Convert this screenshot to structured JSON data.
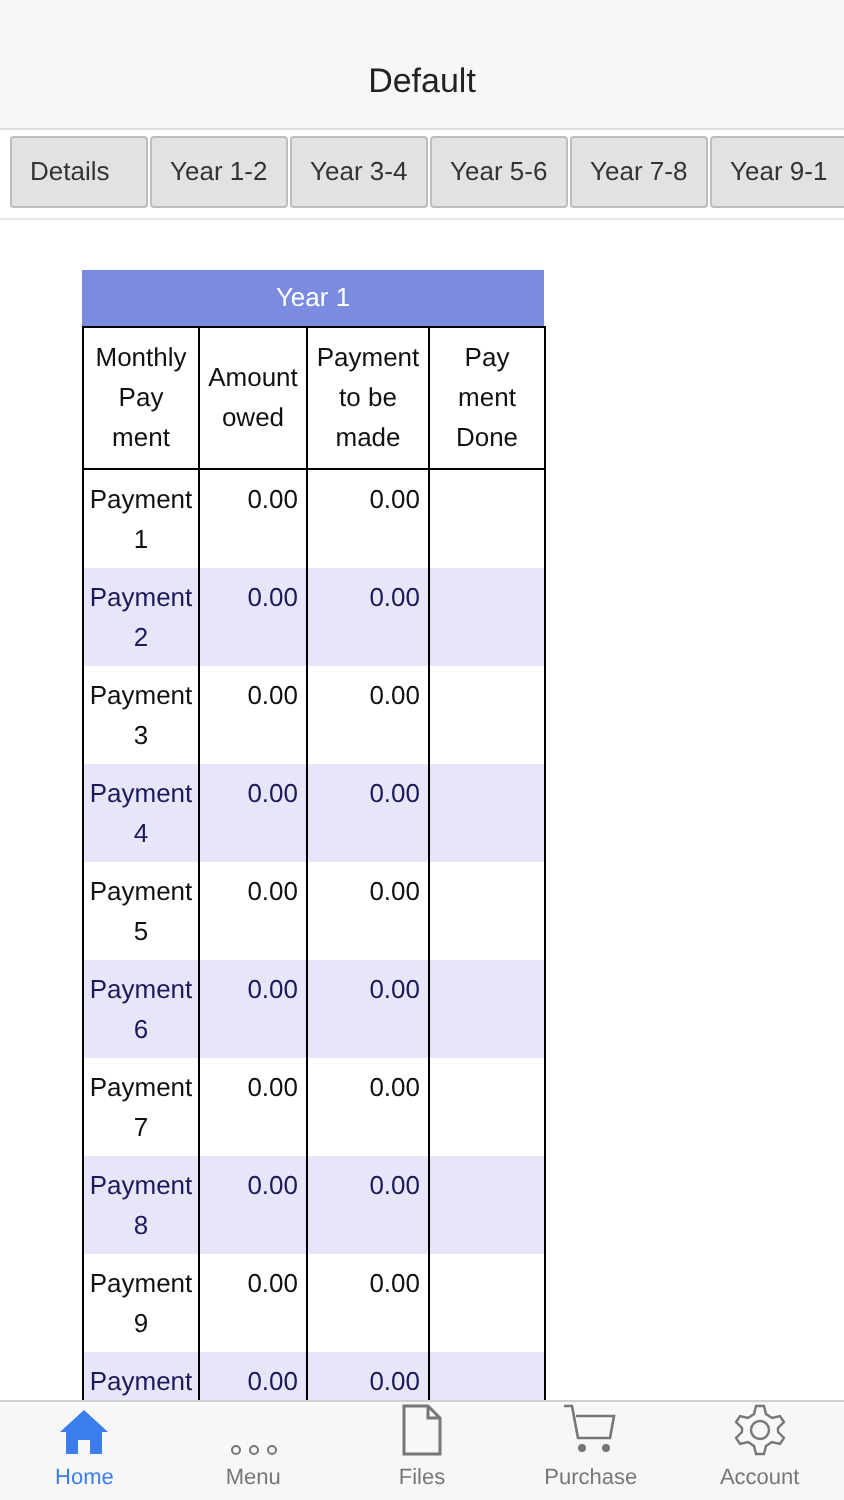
{
  "title": "Default",
  "tabs": [
    "Details",
    "Year 1-2",
    "Year 3-4",
    "Year 5-6",
    "Year 7-8",
    "Year 9-1"
  ],
  "table": {
    "caption": "Year 1",
    "columns": [
      "Monthly\nPay\nment",
      "Amount\nowed",
      "Payment\nto be\nmade",
      "Pay\nment\nDone"
    ],
    "rows": [
      {
        "label": "Payment\n1",
        "amount": "0.00",
        "to_pay": "0.00"
      },
      {
        "label": "Payment\n2",
        "amount": "0.00",
        "to_pay": "0.00"
      },
      {
        "label": "Payment\n3",
        "amount": "0.00",
        "to_pay": "0.00"
      },
      {
        "label": "Payment\n4",
        "amount": "0.00",
        "to_pay": "0.00"
      },
      {
        "label": "Payment\n5",
        "amount": "0.00",
        "to_pay": "0.00"
      },
      {
        "label": "Payment\n6",
        "amount": "0.00",
        "to_pay": "0.00"
      },
      {
        "label": "Payment\n7",
        "amount": "0.00",
        "to_pay": "0.00"
      },
      {
        "label": "Payment\n8",
        "amount": "0.00",
        "to_pay": "0.00"
      },
      {
        "label": "Payment\n9",
        "amount": "0.00",
        "to_pay": "0.00"
      },
      {
        "label": "Payment",
        "amount": "0.00",
        "to_pay": "0.00"
      }
    ]
  },
  "tab_bar": [
    {
      "kind": "home",
      "label": "Home",
      "selected": true
    },
    {
      "kind": "menu",
      "label": "Menu",
      "selected": false
    },
    {
      "kind": "files",
      "label": "Files",
      "selected": false
    },
    {
      "kind": "purchase",
      "label": "Purchase",
      "selected": false
    },
    {
      "kind": "account",
      "label": "Account",
      "selected": false
    }
  ]
}
